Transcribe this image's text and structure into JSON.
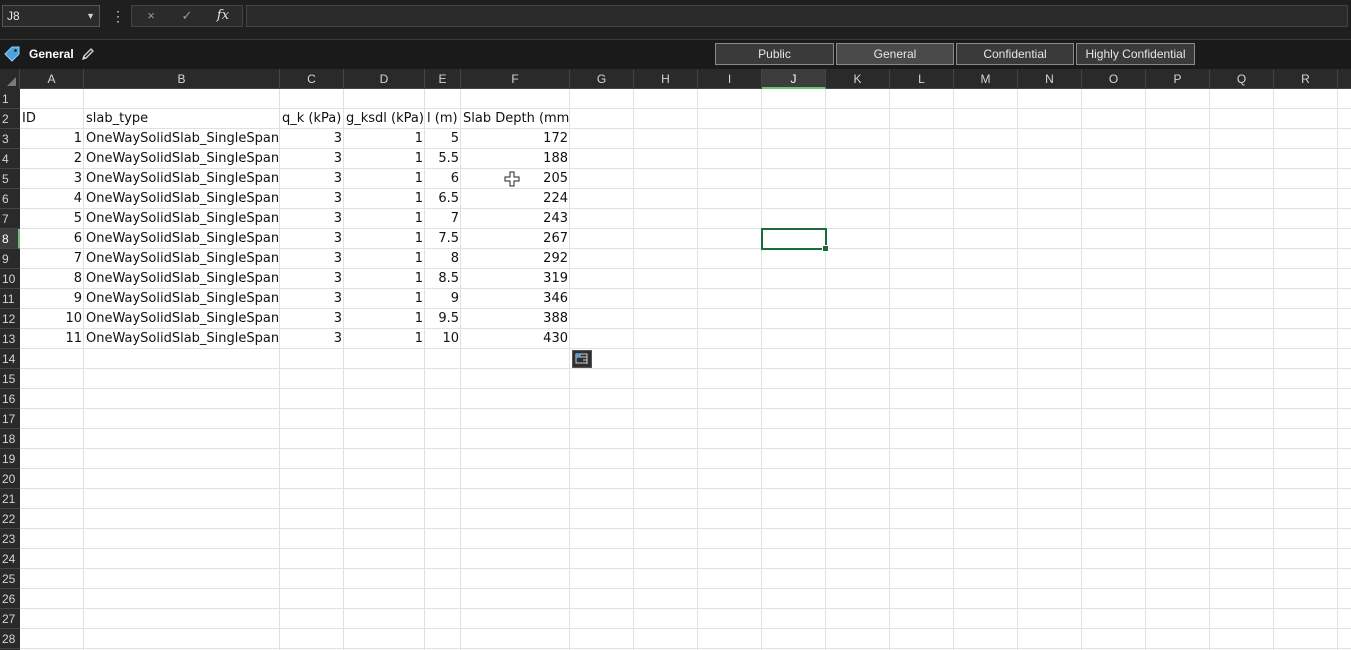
{
  "formula_bar": {
    "name_box": "J8",
    "cancel_icon": "×",
    "enter_icon": "✓",
    "fx_icon": "fx",
    "formula_value": ""
  },
  "sensitivity": {
    "current_label": "General",
    "options": [
      "Public",
      "General",
      "Confidential",
      "Highly Confidential"
    ]
  },
  "columns": [
    "A",
    "B",
    "C",
    "D",
    "E",
    "F",
    "G",
    "H",
    "I",
    "J",
    "K",
    "L",
    "M",
    "N",
    "O",
    "P",
    "Q",
    "R"
  ],
  "selected_column": "J",
  "rows": [
    "1",
    "2",
    "3",
    "4",
    "5",
    "6",
    "7",
    "8",
    "9",
    "10",
    "11",
    "12",
    "13",
    "14",
    "15",
    "16",
    "17",
    "18",
    "19",
    "20",
    "21",
    "22",
    "23",
    "24",
    "25",
    "26",
    "27",
    "28"
  ],
  "selected_row": "8",
  "table": {
    "headers": [
      "ID",
      "slab_type",
      "q_k (kPa)",
      "g_ksdl (kPa)",
      "l (m)",
      "Slab Depth (mm)"
    ],
    "rows": [
      [
        "1",
        "OneWaySolidSlab_SingleSpan",
        "3",
        "1",
        "5",
        "172"
      ],
      [
        "2",
        "OneWaySolidSlab_SingleSpan",
        "3",
        "1",
        "5.5",
        "188"
      ],
      [
        "3",
        "OneWaySolidSlab_SingleSpan",
        "3",
        "1",
        "6",
        "205"
      ],
      [
        "4",
        "OneWaySolidSlab_SingleSpan",
        "3",
        "1",
        "6.5",
        "224"
      ],
      [
        "5",
        "OneWaySolidSlab_SingleSpan",
        "3",
        "1",
        "7",
        "243"
      ],
      [
        "6",
        "OneWaySolidSlab_SingleSpan",
        "3",
        "1",
        "7.5",
        "267"
      ],
      [
        "7",
        "OneWaySolidSlab_SingleSpan",
        "3",
        "1",
        "8",
        "292"
      ],
      [
        "8",
        "OneWaySolidSlab_SingleSpan",
        "3",
        "1",
        "8.5",
        "319"
      ],
      [
        "9",
        "OneWaySolidSlab_SingleSpan",
        "3",
        "1",
        "9",
        "346"
      ],
      [
        "10",
        "OneWaySolidSlab_SingleSpan",
        "3",
        "1",
        "9.5",
        "388"
      ],
      [
        "11",
        "OneWaySolidSlab_SingleSpan",
        "3",
        "1",
        "10",
        "430"
      ]
    ]
  },
  "colors": {
    "accent": "#1e6b3a",
    "header_bg": "#2a2a2a",
    "tag_icon": "#4aa3df"
  },
  "icons": {
    "tag": "sensitivity-tag-icon",
    "pencil": "edit-pencil-icon",
    "quick_analysis": "quick-analysis-icon",
    "cursor": "cell-select-cursor-icon"
  }
}
